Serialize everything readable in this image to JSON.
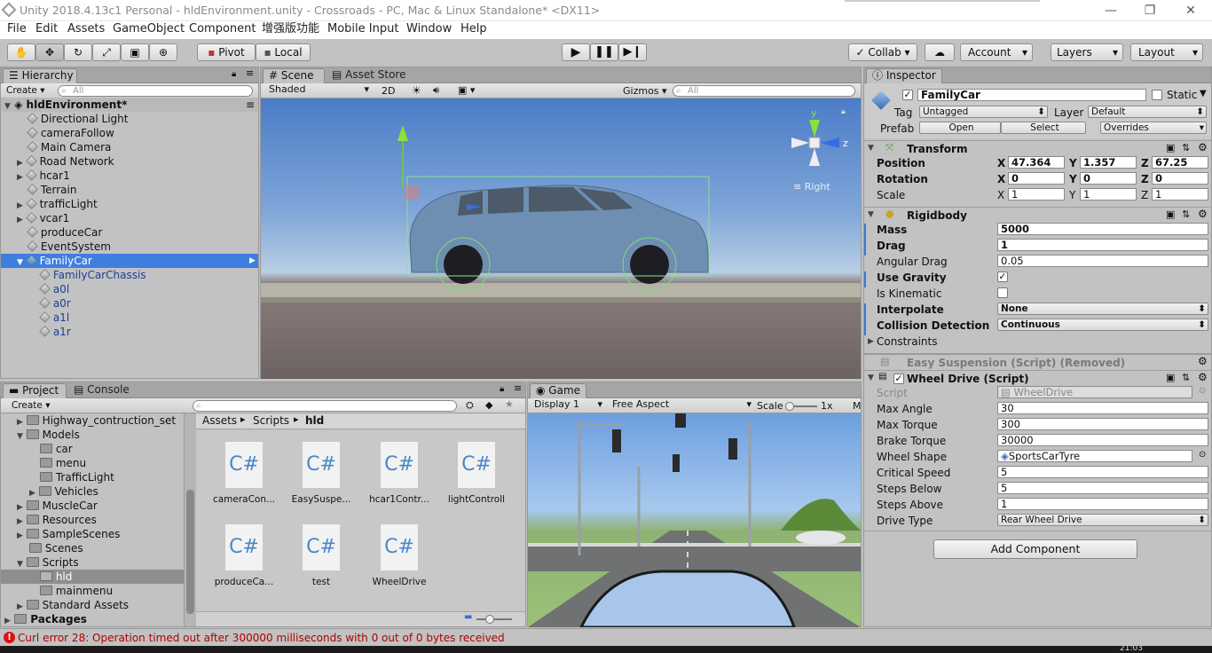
{
  "window": {
    "title": "Unity 2018.4.13c1 Personal - hldEnvironment.unity - Crossroads - PC, Mac & Linux Standalone* <DX11>"
  },
  "menu": [
    "File",
    "Edit",
    "Assets",
    "GameObject",
    "Component",
    "增强版功能",
    "Mobile Input",
    "Window",
    "Help"
  ],
  "toolbar": {
    "pivot": "Pivot",
    "local": "Local",
    "collab": "Collab ▾",
    "account": "Account",
    "layers": "Layers",
    "layout": "Layout"
  },
  "hierarchy": {
    "tab": "Hierarchy",
    "create": "Create ▾",
    "search_placeholder": "All",
    "scene": "hldEnvironment*",
    "items": [
      "Directional Light",
      "cameraFollow",
      "Main Camera",
      "Road Network",
      "hcar1",
      "Terrain",
      "trafficLight",
      "vcar1",
      "produceCar",
      "EventSystem",
      "FamilyCar",
      "FamilyCarChassis",
      "a0l",
      "a0r",
      "a1l",
      "a1r"
    ]
  },
  "scene": {
    "tab": "Scene",
    "tab2": "Asset Store",
    "shading": "Shaded",
    "mode2d": "2D",
    "gizmos": "Gizmos ▾",
    "search_placeholder": "All",
    "view_label": "Right",
    "axis_y": "y",
    "axis_z": "z"
  },
  "project": {
    "tab": "Project",
    "tab2": "Console",
    "create": "Create ▾",
    "tree": [
      "Highway_contruction_set",
      "Models",
      "car",
      "menu",
      "TrafficLight",
      "Vehicles",
      "MuscleCar",
      "Resources",
      "SampleScenes",
      "Scenes",
      "Scripts",
      "hld",
      "mainmenu",
      "Standard Assets",
      "Packages"
    ],
    "breadcrumb": [
      "Assets",
      "Scripts",
      "hld"
    ],
    "files": [
      "cameraCon...",
      "EasySuspe...",
      "hcar1Contr...",
      "lightControll",
      "produceCa...",
      "test",
      "WheelDrive"
    ],
    "cs_label": "C#"
  },
  "game": {
    "tab": "Game",
    "display": "Display 1",
    "aspect": "Free Aspect",
    "scale_label": "Scale",
    "scale_value": "1x",
    "maximize": "M"
  },
  "inspector": {
    "tab": "Inspector",
    "object_name": "FamilyCar",
    "static_label": "Static",
    "tag_label": "Tag",
    "tag": "Untagged",
    "layer_label": "Layer",
    "layer": "Default",
    "prefab_label": "Prefab",
    "open": "Open",
    "select": "Select",
    "overrides": "Overrides",
    "transform": {
      "title": "Transform",
      "position": "Position",
      "rotation": "Rotation",
      "scale": "Scale",
      "pos": [
        "47.364",
        "1.357",
        "67.25"
      ],
      "rot": [
        "0",
        "0",
        "0"
      ],
      "scl": [
        "1",
        "1",
        "1"
      ]
    },
    "rigidbody": {
      "title": "Rigidbody",
      "mass_l": "Mass",
      "mass": "5000",
      "drag_l": "Drag",
      "drag": "1",
      "adrag_l": "Angular Drag",
      "adrag": "0.05",
      "grav_l": "Use Gravity",
      "kin_l": "Is Kinematic",
      "interp_l": "Interpolate",
      "interp": "None",
      "coll_l": "Collision Detection",
      "coll": "Continuous",
      "constraints": "Constraints"
    },
    "easy": "Easy Suspension (Script) (Removed)",
    "wheel": {
      "title": "Wheel Drive (Script)",
      "script_l": "Script",
      "script": "WheelDrive",
      "rows": [
        {
          "l": "Max Angle",
          "v": "30"
        },
        {
          "l": "Max Torque",
          "v": "300"
        },
        {
          "l": "Brake Torque",
          "v": "30000"
        },
        {
          "l": "Wheel Shape",
          "v": "SportsCarTyre"
        },
        {
          "l": "Critical Speed",
          "v": "5"
        },
        {
          "l": "Steps Below",
          "v": "5"
        },
        {
          "l": "Steps Above",
          "v": "1"
        },
        {
          "l": "Drive Type",
          "v": "Rear Wheel Drive"
        }
      ]
    },
    "add_component": "Add Component"
  },
  "status": {
    "message": "Curl error 28: Operation timed out after 300000 milliseconds with 0 out of 0 bytes received",
    "clock": "21:03"
  }
}
